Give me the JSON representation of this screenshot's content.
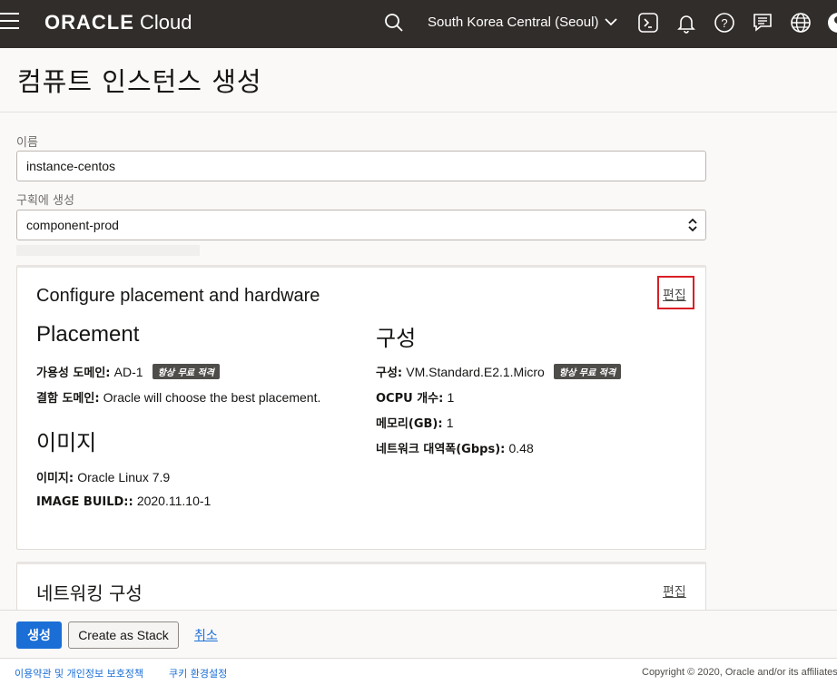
{
  "topbar": {
    "logo_brand": "ORACLE",
    "logo_product": "Cloud",
    "region": "South Korea Central (Seoul)",
    "icons": [
      "menu-icon",
      "search-icon",
      "chevron-down-icon",
      "cloud-shell-icon",
      "bell-icon",
      "help-icon",
      "chat-icon",
      "globe-icon",
      "profile-icon"
    ]
  },
  "page": {
    "title": "컴퓨트 인스턴스 생성"
  },
  "form": {
    "name_label": "이름",
    "name_value": "instance-centos",
    "compartment_label": "구획에 생성",
    "compartment_value": "component-prod"
  },
  "placement_card": {
    "title": "Configure placement and hardware",
    "edit_label": "편집",
    "placement_heading": "Placement",
    "ad_key": "가용성 도메인:",
    "ad_value": "AD-1",
    "free_badge": "항상 무료 적격",
    "fd_key": "결함 도메인:",
    "fd_value": "Oracle will choose the best placement.",
    "image_heading": "이미지",
    "image_key": "이미지:",
    "image_value": "Oracle Linux 7.9",
    "build_key": "IMAGE BUILD::",
    "build_value": "2020.11.10-1",
    "shape_heading": "구성",
    "shape_key": "구성:",
    "shape_value": "VM.Standard.E2.1.Micro",
    "shape_badge": "항상 무료 적격",
    "ocpu_key": "OCPU 개수:",
    "ocpu_value": "1",
    "memory_key": "메모리(GB):",
    "memory_value": "1",
    "bandwidth_key": "네트워크 대역폭(Gbps):",
    "bandwidth_value": "0.48"
  },
  "network_card": {
    "title": "네트워킹 구성",
    "edit_label": "편집"
  },
  "actions": {
    "create_label": "생성",
    "stack_label": "Create as Stack",
    "cancel_label": "취소"
  },
  "footer": {
    "terms": "이용약관 및 개인정보 보호정책",
    "cookies": "쿠키 환경설정",
    "copyright": "Copyright © 2020, Oracle and/or its affiliates."
  },
  "colors": {
    "topbar": "#312d2a",
    "primary": "#1a6ed6",
    "highlight_box": "#d91f26"
  }
}
